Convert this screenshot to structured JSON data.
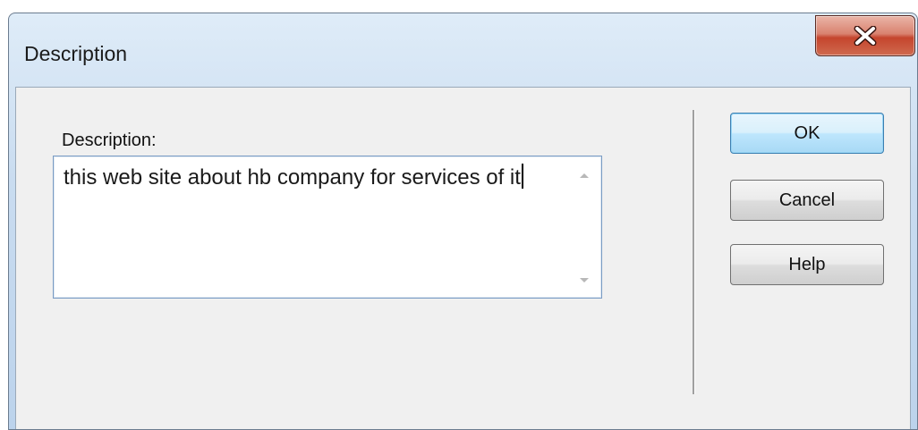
{
  "window": {
    "title": "Description"
  },
  "titlebar": {
    "close_icon": "close-x-icon"
  },
  "form": {
    "field_label": "Description:",
    "field_value": "this web site about hb company for services of it"
  },
  "buttons": {
    "ok": "OK",
    "cancel": "Cancel",
    "help": "Help"
  },
  "colors": {
    "close_button": "#c5452d",
    "default_button_border": "#3c7fb1",
    "titlebar": "#c9dcf0"
  }
}
